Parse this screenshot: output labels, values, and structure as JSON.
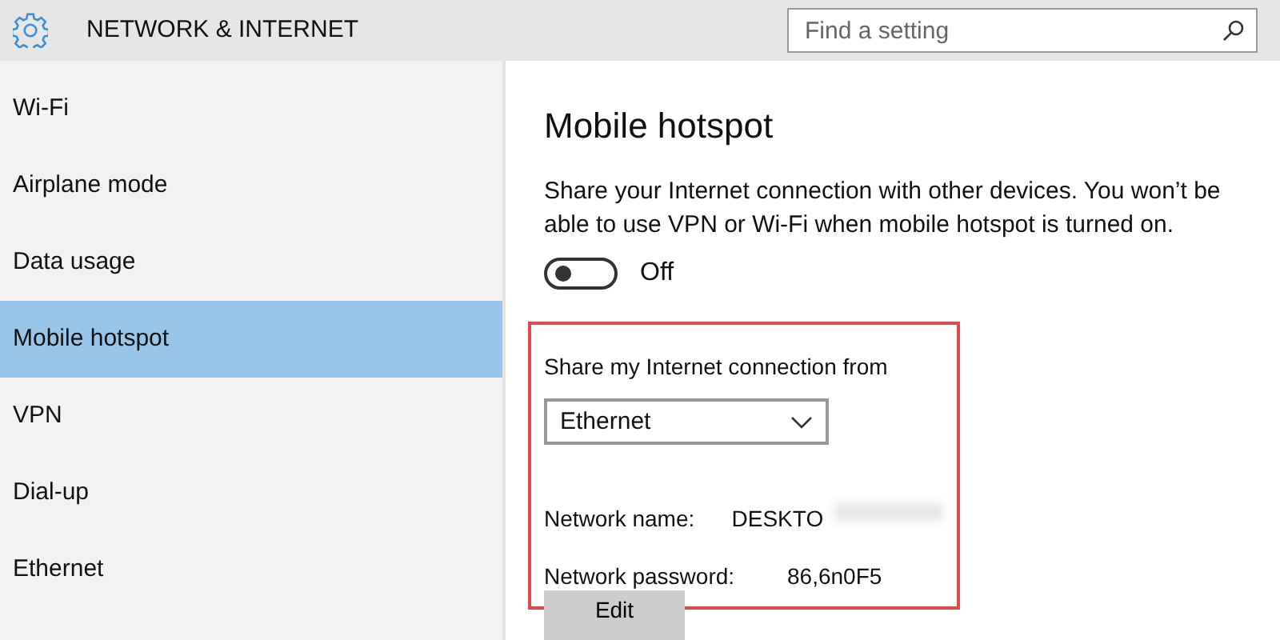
{
  "header": {
    "title": "NETWORK & INTERNET",
    "search": {
      "placeholder": "Find a setting"
    }
  },
  "sidebar": {
    "items": [
      {
        "label": "Wi-Fi",
        "selected": false
      },
      {
        "label": "Airplane mode",
        "selected": false
      },
      {
        "label": "Data usage",
        "selected": false
      },
      {
        "label": "Mobile hotspot",
        "selected": true
      },
      {
        "label": "VPN",
        "selected": false
      },
      {
        "label": "Dial-up",
        "selected": false
      },
      {
        "label": "Ethernet",
        "selected": false
      }
    ]
  },
  "main": {
    "title": "Mobile hotspot",
    "description": "Share your Internet connection with other devices. You won’t be able to use VPN or Wi-Fi when mobile hotspot is turned on.",
    "toggle": {
      "on": false,
      "label": "Off"
    },
    "share_from": {
      "label": "Share my Internet connection from",
      "value": "Ethernet"
    },
    "fields": [
      {
        "label": "Network name:",
        "value": "DESKTO",
        "blurred": true
      },
      {
        "label": "Network password:",
        "value": "86,6n0F5",
        "blurred": false
      }
    ],
    "edit_button": "Edit"
  }
}
